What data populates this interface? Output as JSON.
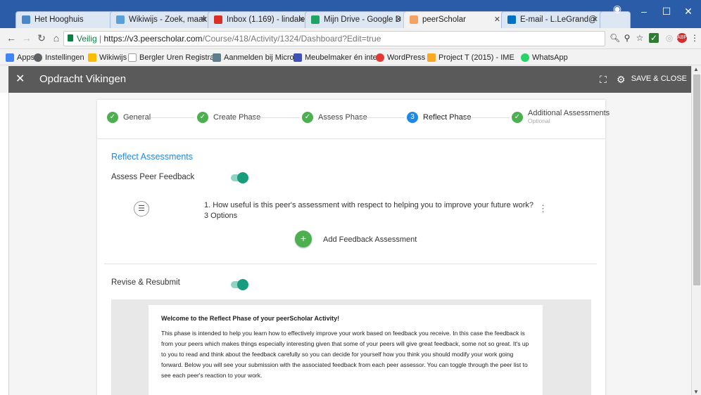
{
  "browser": {
    "tabs": [
      {
        "label": "Het Hooghuis",
        "color": "#4a86c8"
      },
      {
        "label": "Wikiwijs - Zoek, maak",
        "color": "#5aa0d8"
      },
      {
        "label": "Inbox (1.169) - lindale",
        "color": "#d93025"
      },
      {
        "label": "Mijn Drive - Google D",
        "color": "#1fa463"
      },
      {
        "label": "peerScholar",
        "color": "#f4a460",
        "active": true
      },
      {
        "label": "E-mail - L.LeGrand@",
        "color": "#0072c6"
      }
    ],
    "address": {
      "secure_label": "Veilig",
      "url_host": "https://v3.peerscholar.com",
      "url_path": "/Course/418/Activity/1324/Dashboard?Edit=true"
    },
    "bookmarks": [
      {
        "label": "Apps",
        "color": "#4285f4"
      },
      {
        "label": "Instellingen",
        "color": "#5f6368"
      },
      {
        "label": "Wikiwijs",
        "color": "#fbbc05"
      },
      {
        "label": "Bergler Uren Registra",
        "color": "#9e9e9e"
      },
      {
        "label": "Aanmelden bij Micro",
        "color": "#607d8b"
      },
      {
        "label": "Meubelmaker én inte",
        "color": "#3f51b5"
      },
      {
        "label": "WordPress",
        "color": "#e53935"
      },
      {
        "label": "Project T (2015) - IME",
        "color": "#f9a825"
      },
      {
        "label": "WhatsApp",
        "color": "#25d366"
      }
    ]
  },
  "header": {
    "title": "Opdracht Vikingen",
    "save_close": "SAVE & CLOSE"
  },
  "stepper": {
    "steps": [
      {
        "label": "General",
        "state": "done"
      },
      {
        "label": "Create Phase",
        "state": "done"
      },
      {
        "label": "Assess Phase",
        "state": "done"
      },
      {
        "label": "Reflect Phase",
        "state": "active",
        "number": "3"
      },
      {
        "label": "Additional Assessments",
        "sub": "Optional",
        "state": "done"
      }
    ]
  },
  "reflect": {
    "section_title": "Reflect Assessments",
    "assess_peer_feedback_label": "Assess Peer Feedback",
    "assess_peer_feedback_on": true,
    "question": "1. How useful is this peer's assessment with respect to helping you to improve your future work?",
    "question_options": "3 Options",
    "add_feedback_label": "Add Feedback Assessment",
    "add_feedback_button": "+",
    "revise_label": "Revise & Resubmit",
    "revise_on": true
  },
  "editor": {
    "heading": "Welcome to the Reflect Phase of your peerScholar Activity!",
    "paragraph": "This phase is intended to help you learn how to effectively improve your work based on feedback you receive.  In this case the feedback is from your peers which makes things especially interesting given that some of your peers will give great feedback, some not so great. It's up to you to read and think about the feedback carefully so you can decide for yourself how you think you should modify your work going forward. Below you will see your submission with the associated feedback from each peer assessor.  You can toggle through the peer list to see each peer's reaction to your work."
  }
}
